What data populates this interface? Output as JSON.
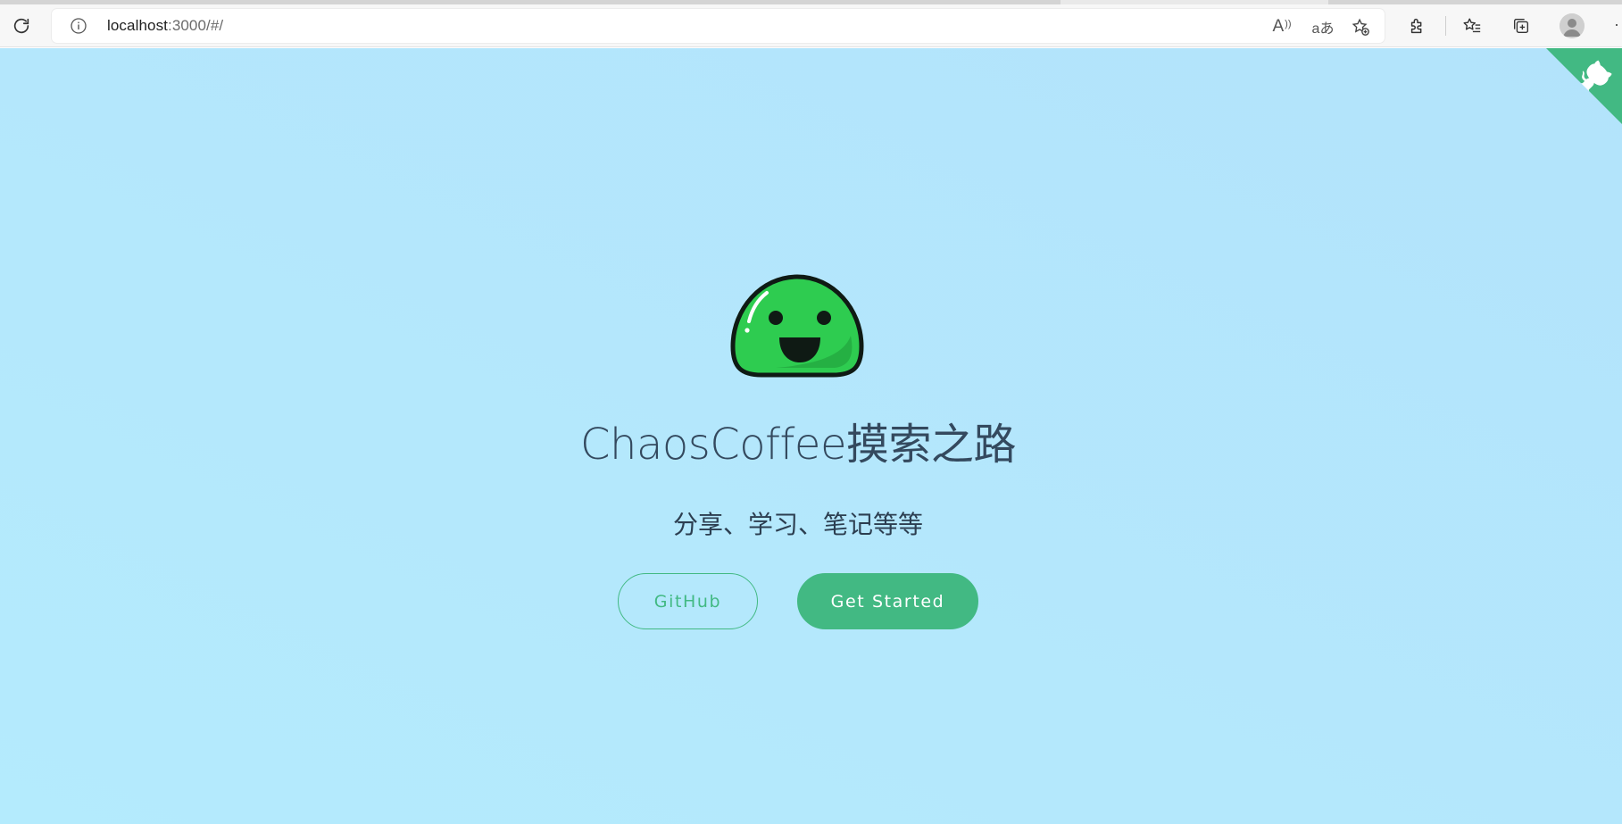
{
  "browser": {
    "url_host": "localhost",
    "url_rest": ":3000/#/",
    "icons": {
      "reload": "reload-icon",
      "info": "info-icon",
      "read_aloud": "read-aloud-icon",
      "translate": "translate-icon",
      "add_favorite": "add-favorite-icon",
      "extensions": "extensions-icon",
      "favorites": "favorites-icon",
      "collections": "collections-icon",
      "profile": "profile-icon",
      "more": "more-icon"
    },
    "read_aloud_glyph": "A",
    "translate_glyph": "aあ",
    "more_glyph": "·"
  },
  "cover": {
    "title": "ChaosCoffee摸索之路",
    "tagline": "分享、学习、笔记等等",
    "buttons": {
      "github": "GitHub",
      "start": "Get Started"
    }
  },
  "colors": {
    "accent": "#42b983",
    "background": "#b4e9fc",
    "title": "#34495e",
    "logo_green": "#2ecc50"
  }
}
